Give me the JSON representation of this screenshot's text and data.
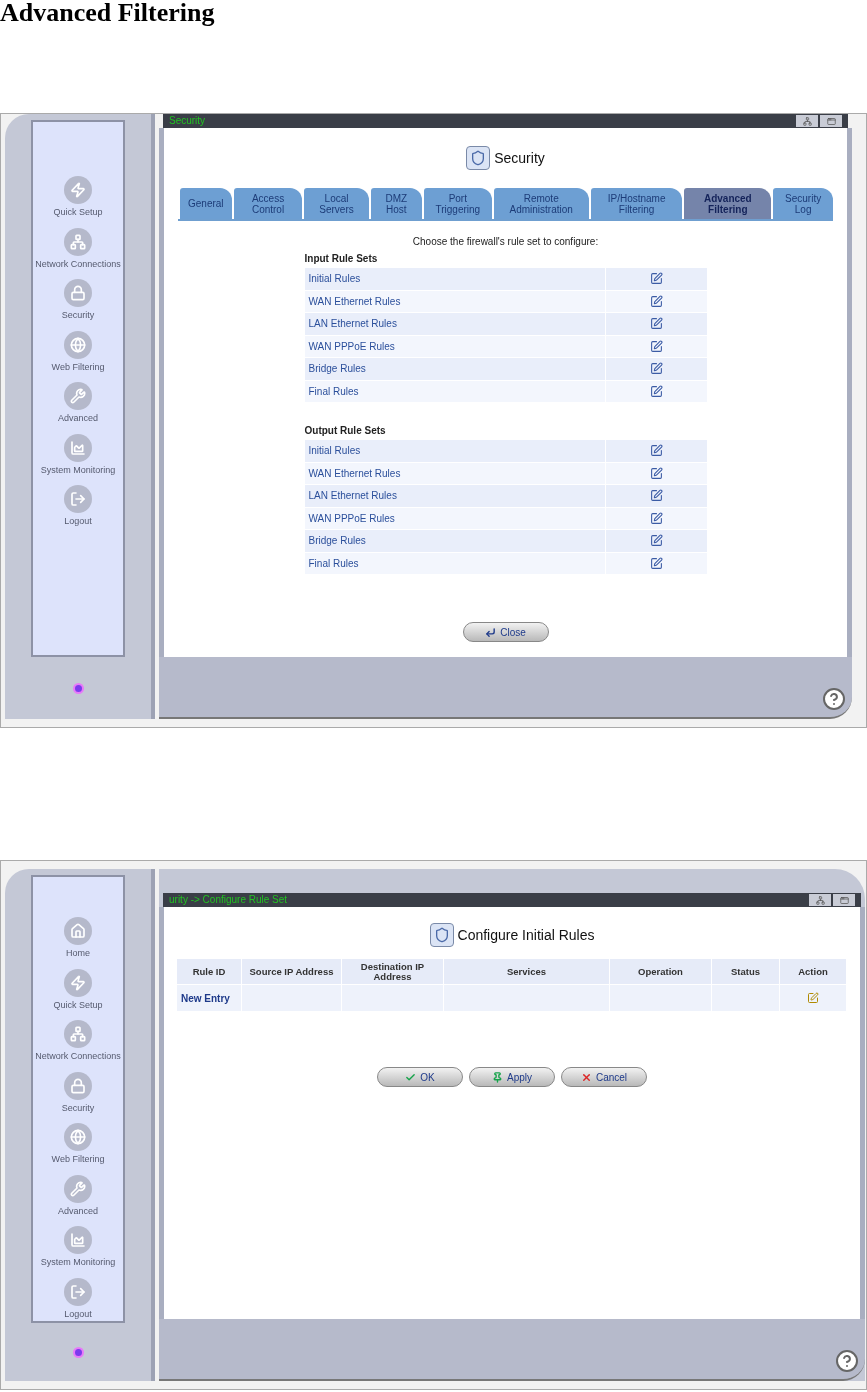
{
  "heading": "Advanced Filtering",
  "screens": [
    {
      "kind": "rule_sets",
      "title_bar": "Security",
      "sidebar": [
        {
          "label": "Quick Setup",
          "kind": "bolt"
        },
        {
          "label": "Network Connections",
          "kind": "network"
        },
        {
          "label": "Security",
          "kind": "lock"
        },
        {
          "label": "Web Filtering",
          "kind": "web"
        },
        {
          "label": "Advanced",
          "kind": "tools"
        },
        {
          "label": "System Monitoring",
          "kind": "monitor"
        },
        {
          "label": "Logout",
          "kind": "logout"
        }
      ],
      "page_title": "Security",
      "tabs": [
        {
          "label": "General",
          "selected": false
        },
        {
          "label": "Access Control",
          "selected": false
        },
        {
          "label": "Local Servers",
          "selected": false
        },
        {
          "label": "DMZ Host",
          "selected": false
        },
        {
          "label": "Port Triggering",
          "selected": false
        },
        {
          "label": "Remote Administration",
          "selected": false
        },
        {
          "label": "IP/Hostname Filtering",
          "selected": false
        },
        {
          "label": "Advanced Filtering",
          "selected": true
        },
        {
          "label": "Security Log",
          "selected": false
        }
      ],
      "prompt": "Choose the firewall's rule set to configure:",
      "rule_groups": [
        {
          "title": "Input Rule Sets",
          "rows": [
            "Initial Rules",
            "WAN Ethernet Rules",
            "LAN Ethernet Rules",
            "WAN PPPoE Rules",
            "Bridge Rules",
            "Final Rules"
          ]
        },
        {
          "title": "Output Rule Sets",
          "rows": [
            "Initial Rules",
            "WAN Ethernet Rules",
            "LAN Ethernet Rules",
            "WAN PPPoE Rules",
            "Bridge Rules",
            "Final Rules"
          ]
        }
      ],
      "buttons": [
        {
          "label": "Close",
          "kind": "enter"
        }
      ]
    },
    {
      "kind": "rule_table",
      "title_bar": "urity -> Configure Rule Set",
      "sidebar": [
        {
          "label": "Home",
          "kind": "home"
        },
        {
          "label": "Quick Setup",
          "kind": "bolt"
        },
        {
          "label": "Network Connections",
          "kind": "network"
        },
        {
          "label": "Security",
          "kind": "lock"
        },
        {
          "label": "Web Filtering",
          "kind": "web"
        },
        {
          "label": "Advanced",
          "kind": "tools"
        },
        {
          "label": "System Monitoring",
          "kind": "monitor"
        },
        {
          "label": "Logout",
          "kind": "logout"
        }
      ],
      "page_title": "Configure Initial Rules",
      "table": {
        "columns": [
          "Rule ID",
          "Source IP Address",
          "Destination IP Address",
          "Services",
          "Operation",
          "Status",
          "Action"
        ],
        "rows": [
          [
            "New Entry",
            "",
            "",
            "",
            "",
            "",
            ""
          ]
        ]
      },
      "buttons": [
        {
          "label": "OK",
          "kind": "check"
        },
        {
          "label": "Apply",
          "kind": "pin"
        },
        {
          "label": "Cancel",
          "kind": "cross"
        }
      ]
    }
  ]
}
